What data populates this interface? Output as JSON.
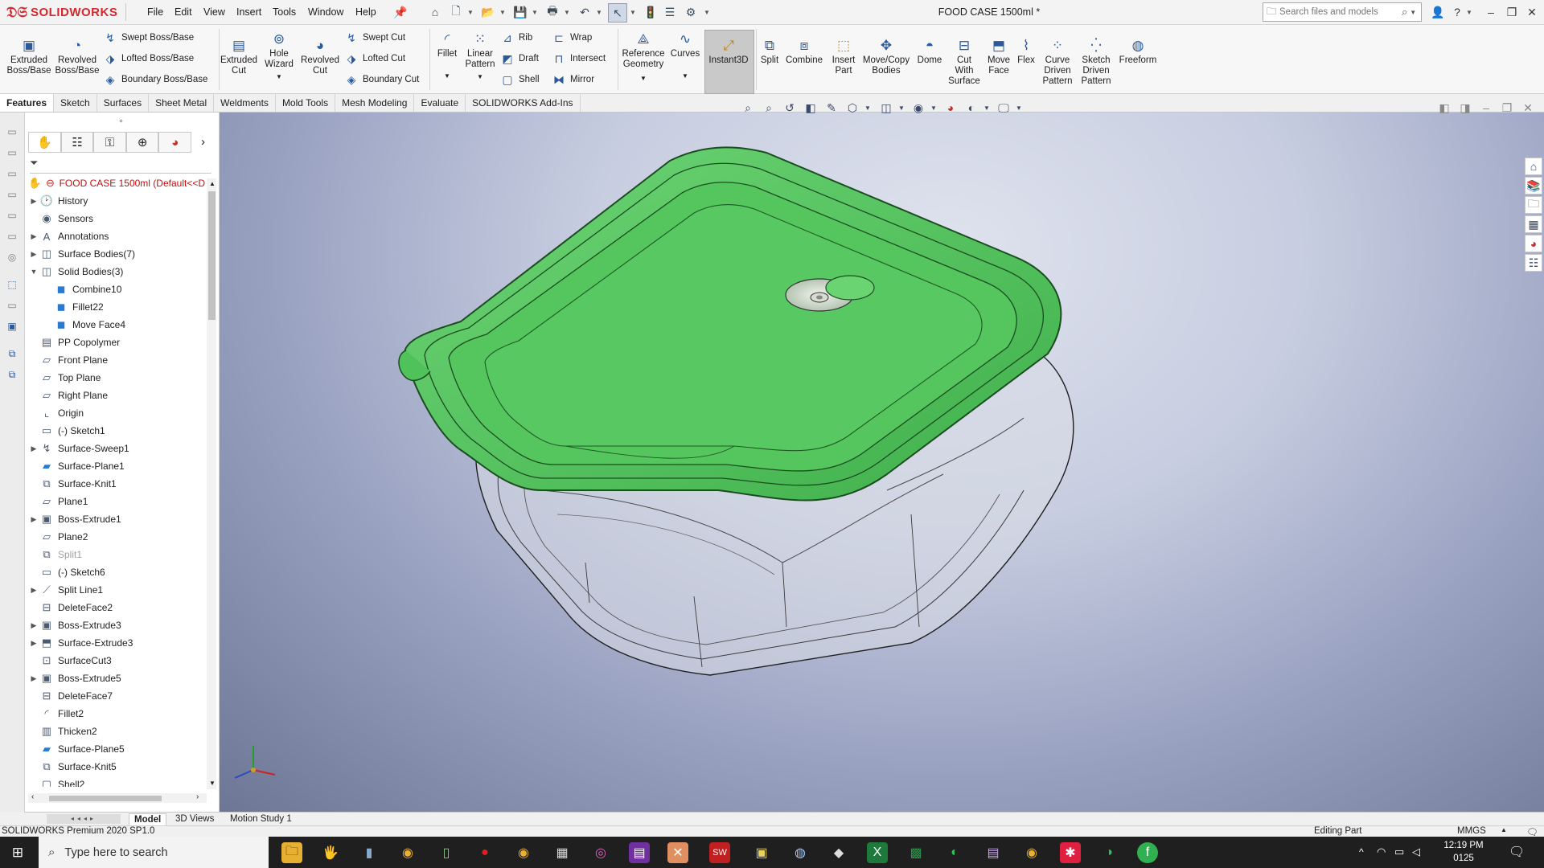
{
  "app": {
    "logo_text": "SOLIDWORKS",
    "document_title": "FOOD CASE 1500ml *"
  },
  "menu": [
    "File",
    "Edit",
    "View",
    "Insert",
    "Tools",
    "Window",
    "Help"
  ],
  "search": {
    "placeholder": "Search files and models"
  },
  "ribbon": {
    "extruded_boss": "Extruded Boss/Base",
    "revolved_boss": "Revolved Boss/Base",
    "swept_boss": "Swept Boss/Base",
    "lofted_boss": "Lofted Boss/Base",
    "boundary_boss": "Boundary Boss/Base",
    "extruded_cut": "Extruded Cut",
    "hole_wizard": "Hole Wizard",
    "revolved_cut": "Revolved Cut",
    "swept_cut": "Swept Cut",
    "lofted_cut": "Lofted Cut",
    "boundary_cut": "Boundary Cut",
    "fillet": "Fillet",
    "linear_pattern": "Linear Pattern",
    "rib": "Rib",
    "draft": "Draft",
    "shell": "Shell",
    "wrap": "Wrap",
    "intersect": "Intersect",
    "mirror": "Mirror",
    "reference_geometry": "Reference Geometry",
    "curves": "Curves",
    "instant3d": "Instant3D",
    "split": "Split",
    "combine": "Combine",
    "insert_part": "Insert Part",
    "move_copy_bodies": "Move/Copy Bodies",
    "dome": "Dome",
    "cut_with_surface": "Cut With Surface",
    "move_face": "Move Face",
    "flex": "Flex",
    "curve_driven_pattern": "Curve Driven Pattern",
    "sketch_driven_pattern": "Sketch Driven Pattern",
    "freeform": "Freeform"
  },
  "tabs": [
    "Features",
    "Sketch",
    "Surfaces",
    "Sheet Metal",
    "Weldments",
    "Mold Tools",
    "Mesh Modeling",
    "Evaluate",
    "SOLIDWORKS Add-Ins"
  ],
  "feature_tree": {
    "root": "FOOD CASE 1500ml  (Default<<D",
    "nodes": [
      {
        "label": "History",
        "icon": "history-icon",
        "expandable": true,
        "indent": 0
      },
      {
        "label": "Sensors",
        "icon": "sensors-icon",
        "expandable": false,
        "indent": 0
      },
      {
        "label": "Annotations",
        "icon": "annotations-icon",
        "expandable": true,
        "indent": 0
      },
      {
        "label": "Surface Bodies(7)",
        "icon": "surface-bodies-icon",
        "expandable": true,
        "indent": 0
      },
      {
        "label": "Solid Bodies(3)",
        "icon": "solid-bodies-icon",
        "expandable": true,
        "expanded": true,
        "indent": 0
      },
      {
        "label": "Combine10",
        "icon": "solid-body-icon",
        "expandable": false,
        "indent": 1
      },
      {
        "label": "Fillet22",
        "icon": "solid-body-icon",
        "expandable": false,
        "indent": 1
      },
      {
        "label": "Move Face4",
        "icon": "solid-body-icon",
        "expandable": false,
        "indent": 1
      },
      {
        "label": "PP Copolymer",
        "icon": "material-icon",
        "expandable": false,
        "indent": 0
      },
      {
        "label": "Front Plane",
        "icon": "plane-icon",
        "expandable": false,
        "indent": 0
      },
      {
        "label": "Top Plane",
        "icon": "plane-icon",
        "expandable": false,
        "indent": 0
      },
      {
        "label": "Right Plane",
        "icon": "plane-icon",
        "expandable": false,
        "indent": 0
      },
      {
        "label": "Origin",
        "icon": "origin-icon",
        "expandable": false,
        "indent": 0
      },
      {
        "label": "(-) Sketch1",
        "icon": "sketch-icon",
        "expandable": false,
        "indent": 0
      },
      {
        "label": "Surface-Sweep1",
        "icon": "surface-sweep-icon",
        "expandable": true,
        "indent": 0
      },
      {
        "label": "Surface-Plane1",
        "icon": "surface-plane-icon",
        "expandable": false,
        "indent": 0
      },
      {
        "label": "Surface-Knit1",
        "icon": "surface-knit-icon",
        "expandable": false,
        "indent": 0
      },
      {
        "label": "Plane1",
        "icon": "plane-icon",
        "expandable": false,
        "indent": 0
      },
      {
        "label": "Boss-Extrude1",
        "icon": "boss-extrude-icon",
        "expandable": true,
        "indent": 0
      },
      {
        "label": "Plane2",
        "icon": "plane-icon",
        "expandable": false,
        "indent": 0
      },
      {
        "label": "Split1",
        "icon": "split-icon",
        "expandable": false,
        "indent": 0,
        "dim": true
      },
      {
        "label": "(-) Sketch6",
        "icon": "sketch-icon",
        "expandable": false,
        "indent": 0
      },
      {
        "label": "Split Line1",
        "icon": "split-line-icon",
        "expandable": true,
        "indent": 0
      },
      {
        "label": "DeleteFace2",
        "icon": "delete-face-icon",
        "expandable": false,
        "indent": 0
      },
      {
        "label": "Boss-Extrude3",
        "icon": "boss-extrude-icon",
        "expandable": true,
        "indent": 0
      },
      {
        "label": "Surface-Extrude3",
        "icon": "surface-extrude-icon",
        "expandable": true,
        "indent": 0
      },
      {
        "label": "SurfaceCut3",
        "icon": "surface-cut-icon",
        "expandable": false,
        "indent": 0
      },
      {
        "label": "Boss-Extrude5",
        "icon": "boss-extrude-icon",
        "expandable": true,
        "indent": 0
      },
      {
        "label": "DeleteFace7",
        "icon": "delete-face-icon",
        "expandable": false,
        "indent": 0
      },
      {
        "label": "Fillet2",
        "icon": "fillet-icon",
        "expandable": false,
        "indent": 0
      },
      {
        "label": "Thicken2",
        "icon": "thicken-icon",
        "expandable": false,
        "indent": 0
      },
      {
        "label": "Surface-Plane5",
        "icon": "surface-plane-icon",
        "expandable": false,
        "indent": 0
      },
      {
        "label": "Surface-Knit5",
        "icon": "surface-knit-icon",
        "expandable": false,
        "indent": 0
      },
      {
        "label": "Shell2",
        "icon": "shell-icon",
        "expandable": false,
        "indent": 0
      }
    ]
  },
  "bottom_tabs": [
    "Model",
    "3D Views",
    "Motion Study 1"
  ],
  "status": {
    "version": "SOLIDWORKS Premium 2020 SP1.0",
    "mode": "Editing Part",
    "units": "MMGS"
  },
  "taskbar": {
    "search_placeholder": "Type here to search",
    "time": "12:19 PM",
    "date": "0125"
  },
  "colors": {
    "brand": "#d4272e",
    "lid_green": "#4fc35a",
    "viewport_top": "#dfe3ee",
    "viewport_bottom": "#6e7696"
  }
}
